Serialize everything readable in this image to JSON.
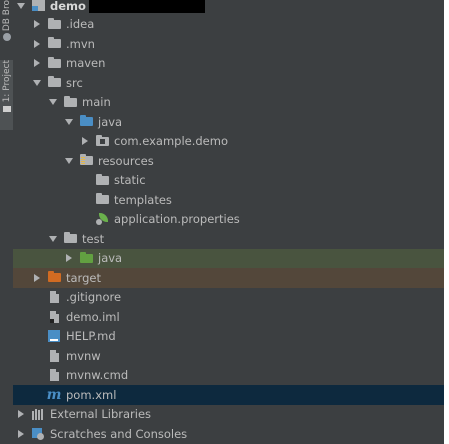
{
  "side_tabs": {
    "db_browser": "DB Bro",
    "project": "1: Project"
  },
  "tree": [
    {
      "name": "tree-root-demo",
      "label": "demo",
      "icon": "module-folder-icon",
      "expanded": true,
      "depth": 0,
      "redacted": true
    },
    {
      "name": "tree-item-idea",
      "label": ".idea",
      "icon": "folder-icon",
      "expanded": false,
      "depth": 1
    },
    {
      "name": "tree-item-mvn",
      "label": ".mvn",
      "icon": "folder-icon",
      "expanded": false,
      "depth": 1
    },
    {
      "name": "tree-item-maven",
      "label": "maven",
      "icon": "folder-icon",
      "expanded": false,
      "depth": 1
    },
    {
      "name": "tree-item-src",
      "label": "src",
      "icon": "folder-icon",
      "expanded": true,
      "depth": 1
    },
    {
      "name": "tree-item-main",
      "label": "main",
      "icon": "folder-icon",
      "expanded": true,
      "depth": 2
    },
    {
      "name": "tree-item-java-main",
      "label": "java",
      "icon": "source-folder-icon",
      "expanded": true,
      "depth": 3
    },
    {
      "name": "tree-item-package",
      "label": "com.example.demo",
      "icon": "package-icon",
      "expanded": false,
      "depth": 4
    },
    {
      "name": "tree-item-resources",
      "label": "resources",
      "icon": "resources-folder-icon",
      "expanded": true,
      "depth": 3
    },
    {
      "name": "tree-item-static",
      "label": "static",
      "icon": "folder-icon",
      "expanded": null,
      "depth": 4
    },
    {
      "name": "tree-item-templates",
      "label": "templates",
      "icon": "folder-icon",
      "expanded": null,
      "depth": 4
    },
    {
      "name": "tree-item-application-properties",
      "label": "application.properties",
      "icon": "spring-properties-icon",
      "expanded": null,
      "depth": 4
    },
    {
      "name": "tree-item-test",
      "label": "test",
      "icon": "folder-icon",
      "expanded": true,
      "depth": 2
    },
    {
      "name": "tree-item-java-test",
      "label": "java",
      "icon": "test-folder-icon",
      "expanded": false,
      "depth": 3
    },
    {
      "name": "tree-item-target",
      "label": "target",
      "icon": "excluded-folder-icon",
      "expanded": false,
      "depth": 1
    },
    {
      "name": "tree-item-gitignore",
      "label": ".gitignore",
      "icon": "file-icon",
      "expanded": null,
      "depth": 1
    },
    {
      "name": "tree-item-demo-iml",
      "label": "demo.iml",
      "icon": "iml-file-icon",
      "expanded": null,
      "depth": 1
    },
    {
      "name": "tree-item-help-md",
      "label": "HELP.md",
      "icon": "markdown-file-icon",
      "expanded": null,
      "depth": 1
    },
    {
      "name": "tree-item-mvnw",
      "label": "mvnw",
      "icon": "file-icon",
      "expanded": null,
      "depth": 1
    },
    {
      "name": "tree-item-mvnw-cmd",
      "label": "mvnw.cmd",
      "icon": "file-icon",
      "expanded": null,
      "depth": 1
    },
    {
      "name": "tree-item-pom-xml",
      "label": "pom.xml",
      "icon": "maven-icon",
      "expanded": null,
      "depth": 1
    },
    {
      "name": "tree-item-external-libraries",
      "label": "External Libraries",
      "icon": "libraries-icon",
      "expanded": false,
      "depth": 0
    },
    {
      "name": "tree-item-scratches",
      "label": "Scratches and Consoles",
      "icon": "scratches-icon",
      "expanded": false,
      "depth": 0
    }
  ],
  "colors": {
    "panel_bg": "#3c3f41",
    "text": "#bbbbbb",
    "test_row_bg": "#49543f",
    "target_row_bg": "#53473a",
    "selected_row_bg": "#0d293e",
    "source_folder": "#4a8ec5",
    "test_folder": "#62a041",
    "excluded_folder": "#d16b22"
  }
}
